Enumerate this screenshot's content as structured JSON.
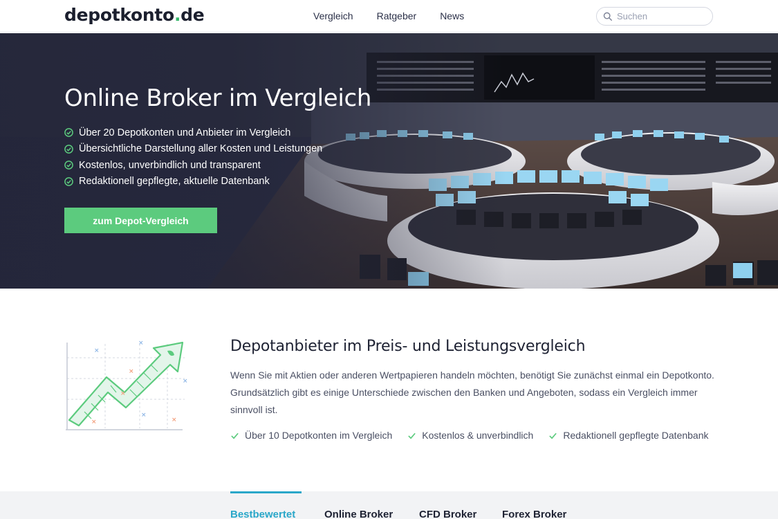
{
  "header": {
    "logo_main": "depotkonto",
    "logo_dot": ".",
    "logo_tld": "de",
    "nav": [
      "Vergleich",
      "Ratgeber",
      "News"
    ],
    "search_placeholder": "Suchen"
  },
  "hero": {
    "title": "Online Broker im Vergleich",
    "bullets": [
      "Über 20 Depotkonten und Anbieter im Vergleich",
      "Übersichtliche Darstellung aller Kosten und Leistungen",
      "Kostenlos, unverbindlich und transparent",
      "Redaktionell gepflegte, aktuelle Datenbank"
    ],
    "cta_label": "zum Depot-Vergleich"
  },
  "intro": {
    "title": "Depotanbieter im Preis- und Leistungsvergleich",
    "text": "Wenn Sie mit Aktien oder anderen Wertpapieren handeln möchten, benötigt Sie zunächst einmal ein Depotkonto. Grundsätzlich gibt es einige Unterschiede zwischen den Banken und Angeboten, sodass ein Vergleich immer sinnvoll ist.",
    "features": [
      "Über 10 Depotkonten im Vergleich",
      "Kostenlos & unverbindlich",
      "Redaktionell gepflegte Datenbank"
    ]
  },
  "tabs": {
    "items": [
      "Bestbewertet",
      "Online Broker",
      "CFD Broker",
      "Forex Broker"
    ],
    "active": "Bestbewertet"
  },
  "colors": {
    "accent_green": "#5ccb7e",
    "accent_blue": "#2aa7c9",
    "logo_dot": "#35b86b",
    "hero_dark": "#2b2d42"
  },
  "icons": {
    "search": "search-icon",
    "check": "check-icon",
    "illustration": "rising-arrow-chart-illustration"
  }
}
